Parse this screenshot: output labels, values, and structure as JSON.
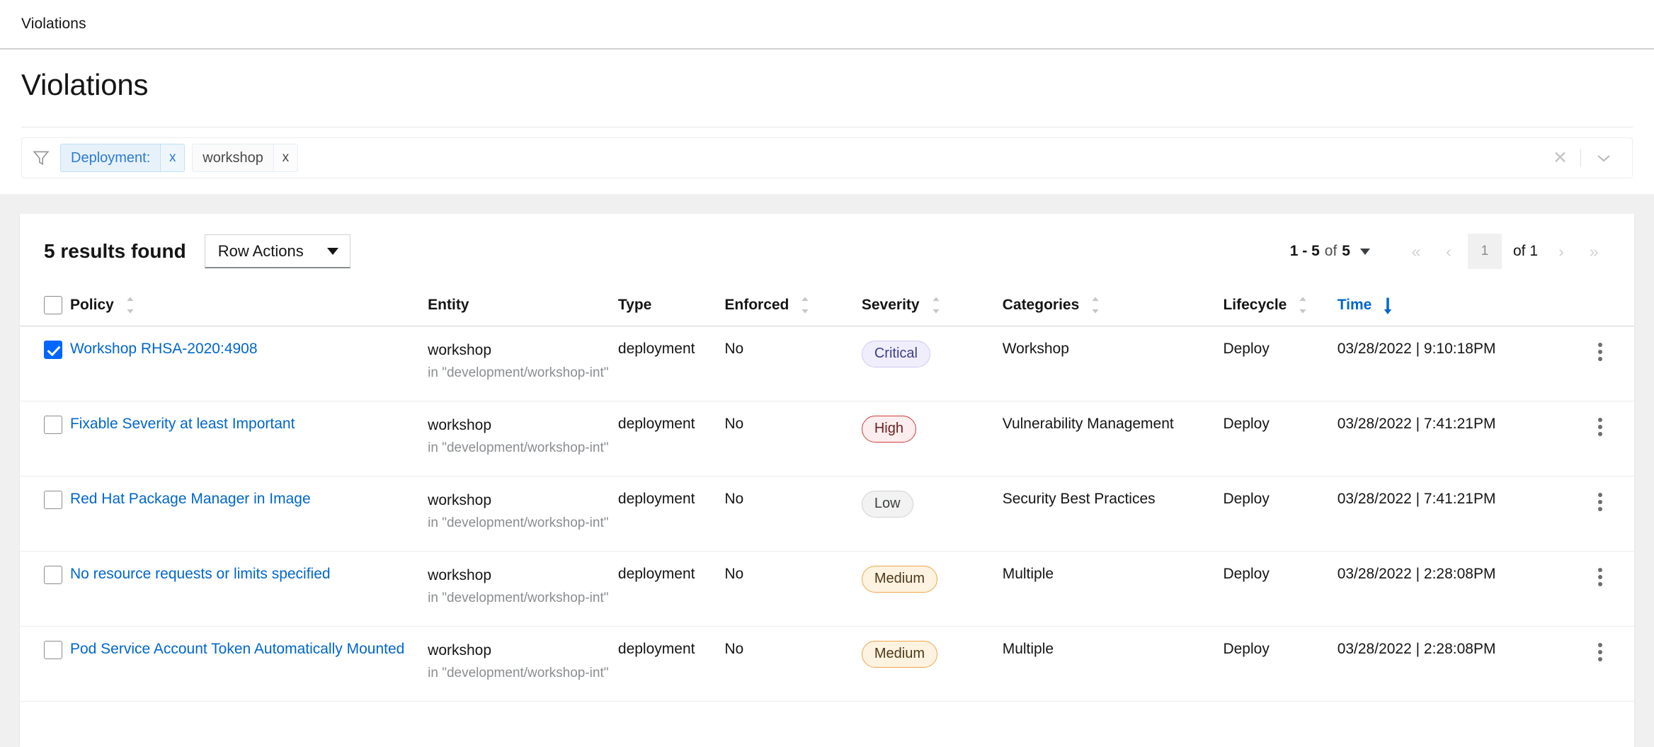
{
  "breadcrumb": {
    "item": "Violations"
  },
  "header": {
    "title": "Violations"
  },
  "filter": {
    "funnel_icon": "filter-funnel-icon",
    "chips": [
      {
        "label": "Deployment:",
        "type": "key",
        "remove_label": "x"
      },
      {
        "label": "workshop",
        "type": "value",
        "remove_label": "x"
      }
    ],
    "clear_all_icon": "close-icon",
    "expand_icon": "chevron-down-icon"
  },
  "toolbar": {
    "results_found": "5 results found",
    "row_actions_label": "Row Actions",
    "row_actions_icon": "caret-down-icon"
  },
  "pagination": {
    "range_prefix": "1 - 5",
    "range_of": "of",
    "range_total": "5",
    "options_icon": "caret-down-icon",
    "first_icon": "«",
    "prev_icon": "‹",
    "next_icon": "›",
    "last_icon": "»",
    "current_page": "1",
    "page_of_label": "of 1"
  },
  "table": {
    "select_all_name": "select-all-checkbox",
    "columns": [
      {
        "label": "Policy",
        "sortable": true,
        "active": false
      },
      {
        "label": "Entity",
        "sortable": false,
        "active": false
      },
      {
        "label": "Type",
        "sortable": false,
        "active": false
      },
      {
        "label": "Enforced",
        "sortable": true,
        "active": false
      },
      {
        "label": "Severity",
        "sortable": true,
        "active": false
      },
      {
        "label": "Categories",
        "sortable": true,
        "active": false
      },
      {
        "label": "Lifecycle",
        "sortable": true,
        "active": false
      },
      {
        "label": "Time",
        "sortable": true,
        "active": true
      }
    ],
    "rows": [
      {
        "selected": true,
        "policy": "Workshop RHSA-2020:4908",
        "entity": "workshop",
        "entity_sub": "in \"development/workshop-int\"",
        "type": "deployment",
        "enforced": "No",
        "severity": "Critical",
        "severity_class": "critical",
        "categories": "Workshop",
        "lifecycle": "Deploy",
        "time": "03/28/2022 | 9:10:18PM"
      },
      {
        "selected": false,
        "policy": "Fixable Severity at least Important",
        "entity": "workshop",
        "entity_sub": "in \"development/workshop-int\"",
        "type": "deployment",
        "enforced": "No",
        "severity": "High",
        "severity_class": "high",
        "categories": "Vulnerability Management",
        "lifecycle": "Deploy",
        "time": "03/28/2022 | 7:41:21PM"
      },
      {
        "selected": false,
        "policy": "Red Hat Package Manager in Image",
        "entity": "workshop",
        "entity_sub": "in \"development/workshop-int\"",
        "type": "deployment",
        "enforced": "No",
        "severity": "Low",
        "severity_class": "low",
        "categories": "Security Best Practices",
        "lifecycle": "Deploy",
        "time": "03/28/2022 | 7:41:21PM"
      },
      {
        "selected": false,
        "policy": "No resource requests or limits specified",
        "entity": "workshop",
        "entity_sub": "in \"development/workshop-int\"",
        "type": "deployment",
        "enforced": "No",
        "severity": "Medium",
        "severity_class": "medium",
        "categories": "Multiple",
        "lifecycle": "Deploy",
        "time": "03/28/2022 | 2:28:08PM"
      },
      {
        "selected": false,
        "policy": "Pod Service Account Token Automatically Mounted",
        "entity": "workshop",
        "entity_sub": "in \"development/workshop-int\"",
        "type": "deployment",
        "enforced": "No",
        "severity": "Medium",
        "severity_class": "medium",
        "categories": "Multiple",
        "lifecycle": "Deploy",
        "time": "03/28/2022 | 2:28:08PM"
      }
    ],
    "row_menu_icon": "kebab-menu-icon"
  },
  "colors": {
    "link": "#0066cc",
    "accent": "#0066ff",
    "critical": "#3c3d8c",
    "high": "#d13b3b",
    "medium": "#eda64a",
    "low": "#d2d2d2"
  }
}
